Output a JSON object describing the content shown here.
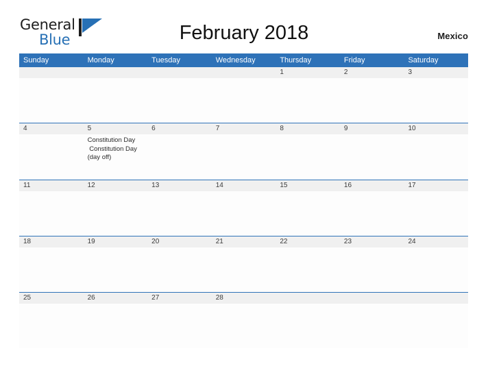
{
  "brand": {
    "name_part1": "General",
    "name_part2": "Blue",
    "mark_icon": "blue-triangle-flag-icon",
    "accent_color": "#2770b5"
  },
  "header": {
    "title": "February 2018",
    "country": "Mexico"
  },
  "colors": {
    "header_band": "#2e72b8",
    "date_band": "#f0f0f0",
    "row_divider": "#2e72b8",
    "page_background": "#ffffff",
    "text": "#222222"
  },
  "calendar": {
    "month": "February",
    "year": "2018",
    "weekdays": [
      "Sunday",
      "Monday",
      "Tuesday",
      "Wednesday",
      "Thursday",
      "Friday",
      "Saturday"
    ],
    "weeks": [
      {
        "days": [
          {
            "date": "",
            "events": []
          },
          {
            "date": "",
            "events": []
          },
          {
            "date": "",
            "events": []
          },
          {
            "date": "",
            "events": []
          },
          {
            "date": "1",
            "events": []
          },
          {
            "date": "2",
            "events": []
          },
          {
            "date": "3",
            "events": []
          }
        ]
      },
      {
        "days": [
          {
            "date": "4",
            "events": []
          },
          {
            "date": "5",
            "events": [
              "Constitution Day",
              " Constitution Day",
              "(day off)"
            ]
          },
          {
            "date": "6",
            "events": []
          },
          {
            "date": "7",
            "events": []
          },
          {
            "date": "8",
            "events": []
          },
          {
            "date": "9",
            "events": []
          },
          {
            "date": "10",
            "events": []
          }
        ]
      },
      {
        "days": [
          {
            "date": "11",
            "events": []
          },
          {
            "date": "12",
            "events": []
          },
          {
            "date": "13",
            "events": []
          },
          {
            "date": "14",
            "events": []
          },
          {
            "date": "15",
            "events": []
          },
          {
            "date": "16",
            "events": []
          },
          {
            "date": "17",
            "events": []
          }
        ]
      },
      {
        "days": [
          {
            "date": "18",
            "events": []
          },
          {
            "date": "19",
            "events": []
          },
          {
            "date": "20",
            "events": []
          },
          {
            "date": "21",
            "events": []
          },
          {
            "date": "22",
            "events": []
          },
          {
            "date": "23",
            "events": []
          },
          {
            "date": "24",
            "events": []
          }
        ]
      },
      {
        "days": [
          {
            "date": "25",
            "events": []
          },
          {
            "date": "26",
            "events": []
          },
          {
            "date": "27",
            "events": []
          },
          {
            "date": "28",
            "events": []
          },
          {
            "date": "",
            "events": []
          },
          {
            "date": "",
            "events": []
          },
          {
            "date": "",
            "events": []
          }
        ]
      }
    ]
  }
}
